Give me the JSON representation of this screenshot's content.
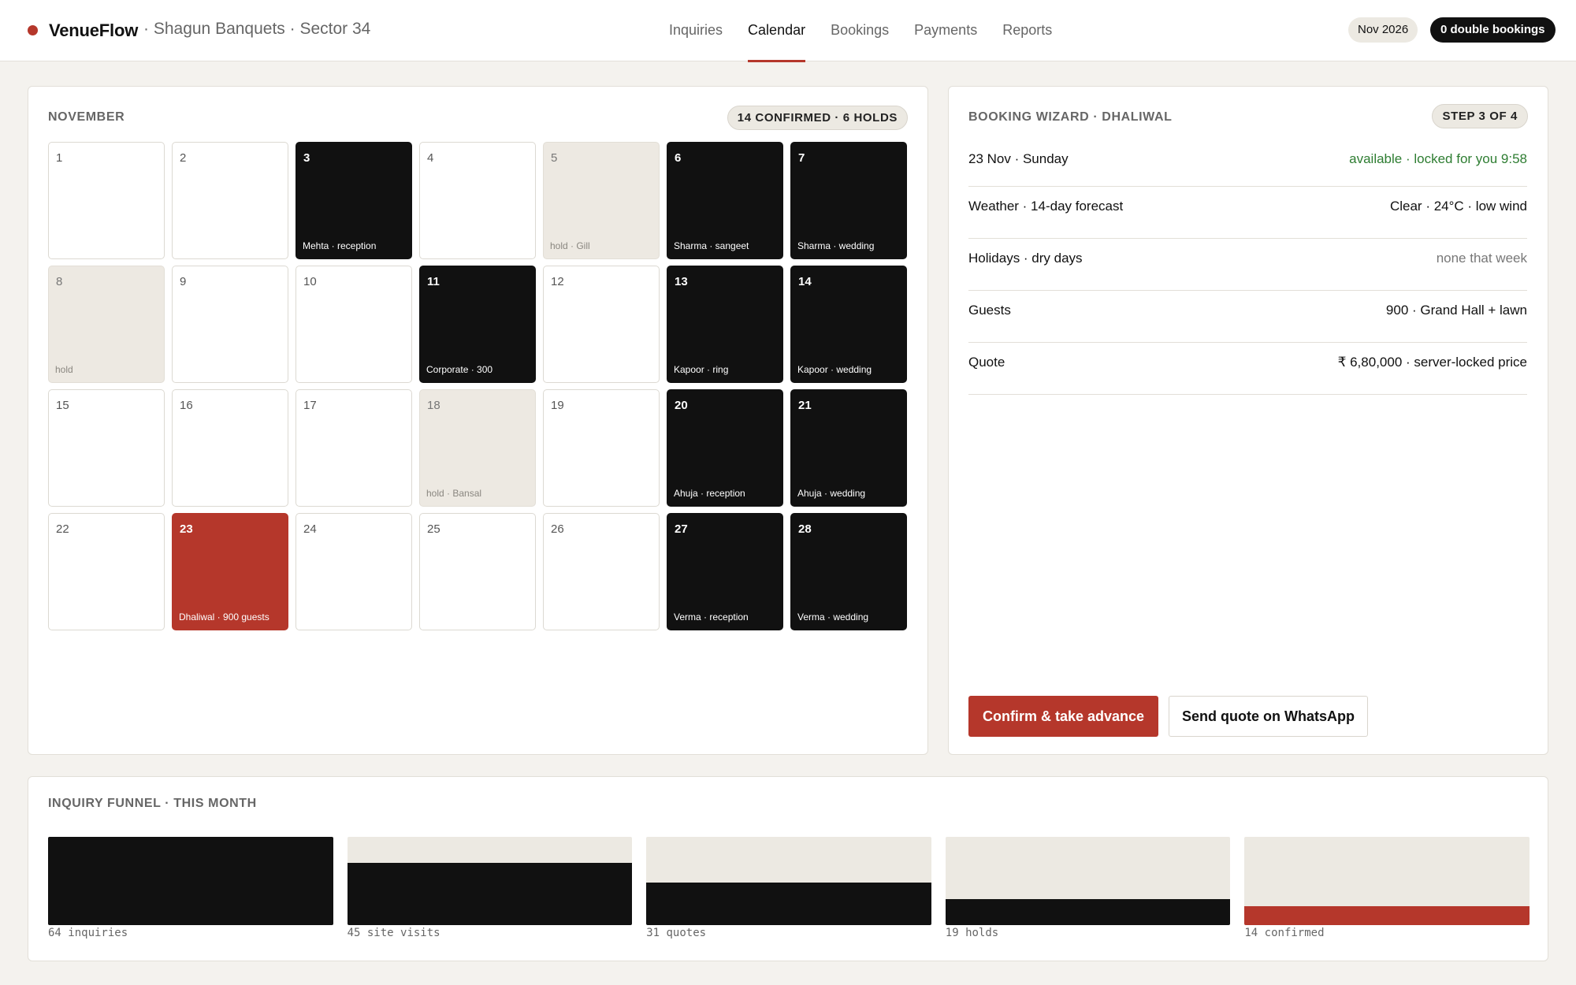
{
  "app": {
    "name": "VenueFlow",
    "venue": "· Shagun Banquets · Sector 34"
  },
  "nav": [
    {
      "label": "Inquiries",
      "active": false
    },
    {
      "label": "Calendar",
      "active": true
    },
    {
      "label": "Bookings",
      "active": false
    },
    {
      "label": "Payments",
      "active": false
    },
    {
      "label": "Reports",
      "active": false
    }
  ],
  "header": {
    "month": "Nov 2026",
    "double_bookings": "0 double bookings"
  },
  "calendar": {
    "title": "NOVEMBER",
    "summary": "14 CONFIRMED · 6 HOLDS",
    "days": [
      {
        "num": "1",
        "status": "free",
        "label": ""
      },
      {
        "num": "2",
        "status": "free",
        "label": ""
      },
      {
        "num": "3",
        "status": "booked",
        "label": "Mehta · reception"
      },
      {
        "num": "4",
        "status": "free",
        "label": ""
      },
      {
        "num": "5",
        "status": "hold",
        "label": "hold · Gill"
      },
      {
        "num": "6",
        "status": "booked",
        "label": "Sharma · sangeet"
      },
      {
        "num": "7",
        "status": "booked",
        "label": "Sharma · wedding"
      },
      {
        "num": "8",
        "status": "hold",
        "label": "hold"
      },
      {
        "num": "9",
        "status": "free",
        "label": ""
      },
      {
        "num": "10",
        "status": "free",
        "label": ""
      },
      {
        "num": "11",
        "status": "booked",
        "label": "Corporate · 300"
      },
      {
        "num": "12",
        "status": "free",
        "label": ""
      },
      {
        "num": "13",
        "status": "booked",
        "label": "Kapoor · ring"
      },
      {
        "num": "14",
        "status": "booked",
        "label": "Kapoor · wedding"
      },
      {
        "num": "15",
        "status": "free",
        "label": ""
      },
      {
        "num": "16",
        "status": "free",
        "label": ""
      },
      {
        "num": "17",
        "status": "free",
        "label": ""
      },
      {
        "num": "18",
        "status": "hold",
        "label": "hold · Bansal"
      },
      {
        "num": "19",
        "status": "free",
        "label": ""
      },
      {
        "num": "20",
        "status": "booked",
        "label": "Ahuja · reception"
      },
      {
        "num": "21",
        "status": "booked",
        "label": "Ahuja · wedding"
      },
      {
        "num": "22",
        "status": "free",
        "label": ""
      },
      {
        "num": "23",
        "status": "selected",
        "label": "Dhaliwal · 900 guests"
      },
      {
        "num": "24",
        "status": "free",
        "label": ""
      },
      {
        "num": "25",
        "status": "free",
        "label": ""
      },
      {
        "num": "26",
        "status": "free",
        "label": ""
      },
      {
        "num": "27",
        "status": "booked",
        "label": "Verma · reception"
      },
      {
        "num": "28",
        "status": "booked",
        "label": "Verma · wedding"
      }
    ]
  },
  "wizard": {
    "title": "BOOKING WIZARD · DHALIWAL",
    "step": "STEP 3 OF 4",
    "rows": [
      {
        "key": "23 Nov · Sunday",
        "value": "available · locked for you 9:58",
        "tone": "green"
      },
      {
        "key": "Weather · 14-day forecast",
        "value": "Clear · 24°C · low wind",
        "tone": "normal"
      },
      {
        "key": "Holidays · dry days",
        "value": "none that week",
        "tone": "muted"
      },
      {
        "key": "Guests",
        "value": "900 · Grand Hall + lawn",
        "tone": "normal"
      },
      {
        "key": "Quote",
        "value": "₹ 6,80,000 · server-locked price",
        "tone": "normal"
      }
    ],
    "confirm_label": "Confirm & take advance",
    "whatsapp_label": "Send quote on WhatsApp"
  },
  "funnel": {
    "title": "INQUIRY FUNNEL · THIS MONTH",
    "stages": [
      {
        "label": "64 inquiries",
        "value": 64,
        "accent": false
      },
      {
        "label": "45 site visits",
        "value": 45,
        "accent": false
      },
      {
        "label": "31 quotes",
        "value": 31,
        "accent": false
      },
      {
        "label": "19 holds",
        "value": 19,
        "accent": false
      },
      {
        "label": "14 confirmed",
        "value": 14,
        "accent": true
      }
    ]
  },
  "colors": {
    "accent": "#b5372b",
    "booked": "#111111",
    "hold": "#ede9e2",
    "available": "#2e7d32"
  }
}
